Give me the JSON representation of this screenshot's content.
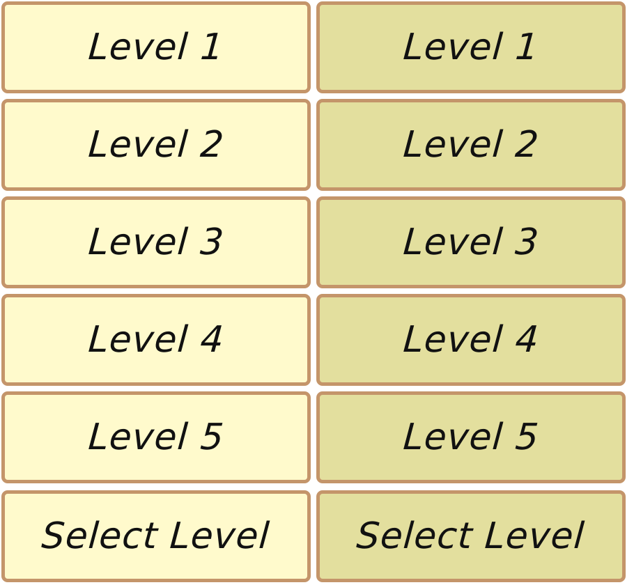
{
  "colors": {
    "border": "#c4956a",
    "normal_fill": "#fffacc",
    "hover_fill": "#e3df9e",
    "text": "#111111"
  },
  "normal": {
    "level_1": "Level 1",
    "level_2": "Level 2",
    "level_3": "Level 3",
    "level_4": "Level 4",
    "level_5": "Level 5",
    "select": "Select Level"
  },
  "hover": {
    "level_1": "Level 1",
    "level_2": "Level 2",
    "level_3": "Level 3",
    "level_4": "Level 4",
    "level_5": "Level 5",
    "select": "Select Level"
  }
}
